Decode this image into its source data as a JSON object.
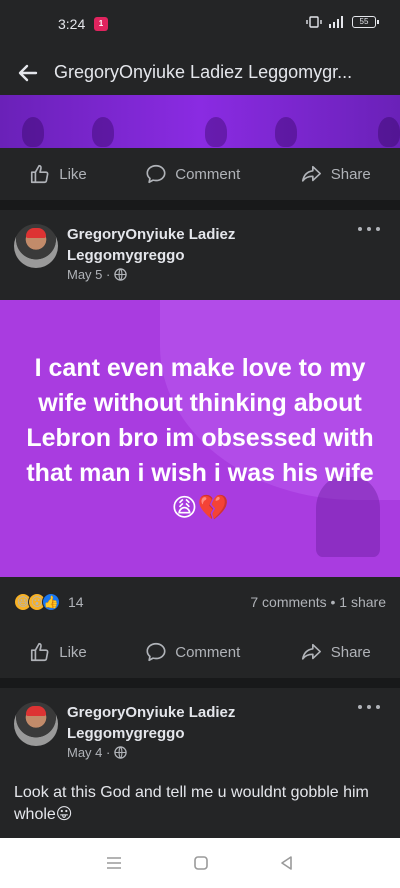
{
  "status": {
    "time": "3:24",
    "badge": "1",
    "battery": "55"
  },
  "header": {
    "title": "GregoryOnyiuke Ladiez Leggomygr..."
  },
  "actions": {
    "like": "Like",
    "comment": "Comment",
    "share": "Share"
  },
  "posts": [
    {
      "author": "GregoryOnyiuke Ladiez Leggomygreggo",
      "date": "May 5 ·",
      "panel_text": "I cant even make love to my wife without thinking about Lebron bro im obsessed with that man i wish i was his wife😩💔",
      "reaction_count": "14",
      "comments_shares": "7 comments • 1 share"
    },
    {
      "author": "GregoryOnyiuke Ladiez Leggomygreggo",
      "date": "May 4 ·",
      "text": "Look at this God and tell me u wouldnt gobble him whole😛"
    }
  ],
  "colors": {
    "background": "#18191a",
    "surface": "#242526",
    "accent": "#a93ce0",
    "text": "#e4e6eb",
    "muted": "#b0b3b8"
  },
  "icons": [
    "back-arrow-icon",
    "like-icon",
    "comment-icon",
    "share-icon",
    "globe-icon",
    "more-icon",
    "menu-icon",
    "home-icon",
    "back-nav-icon"
  ]
}
